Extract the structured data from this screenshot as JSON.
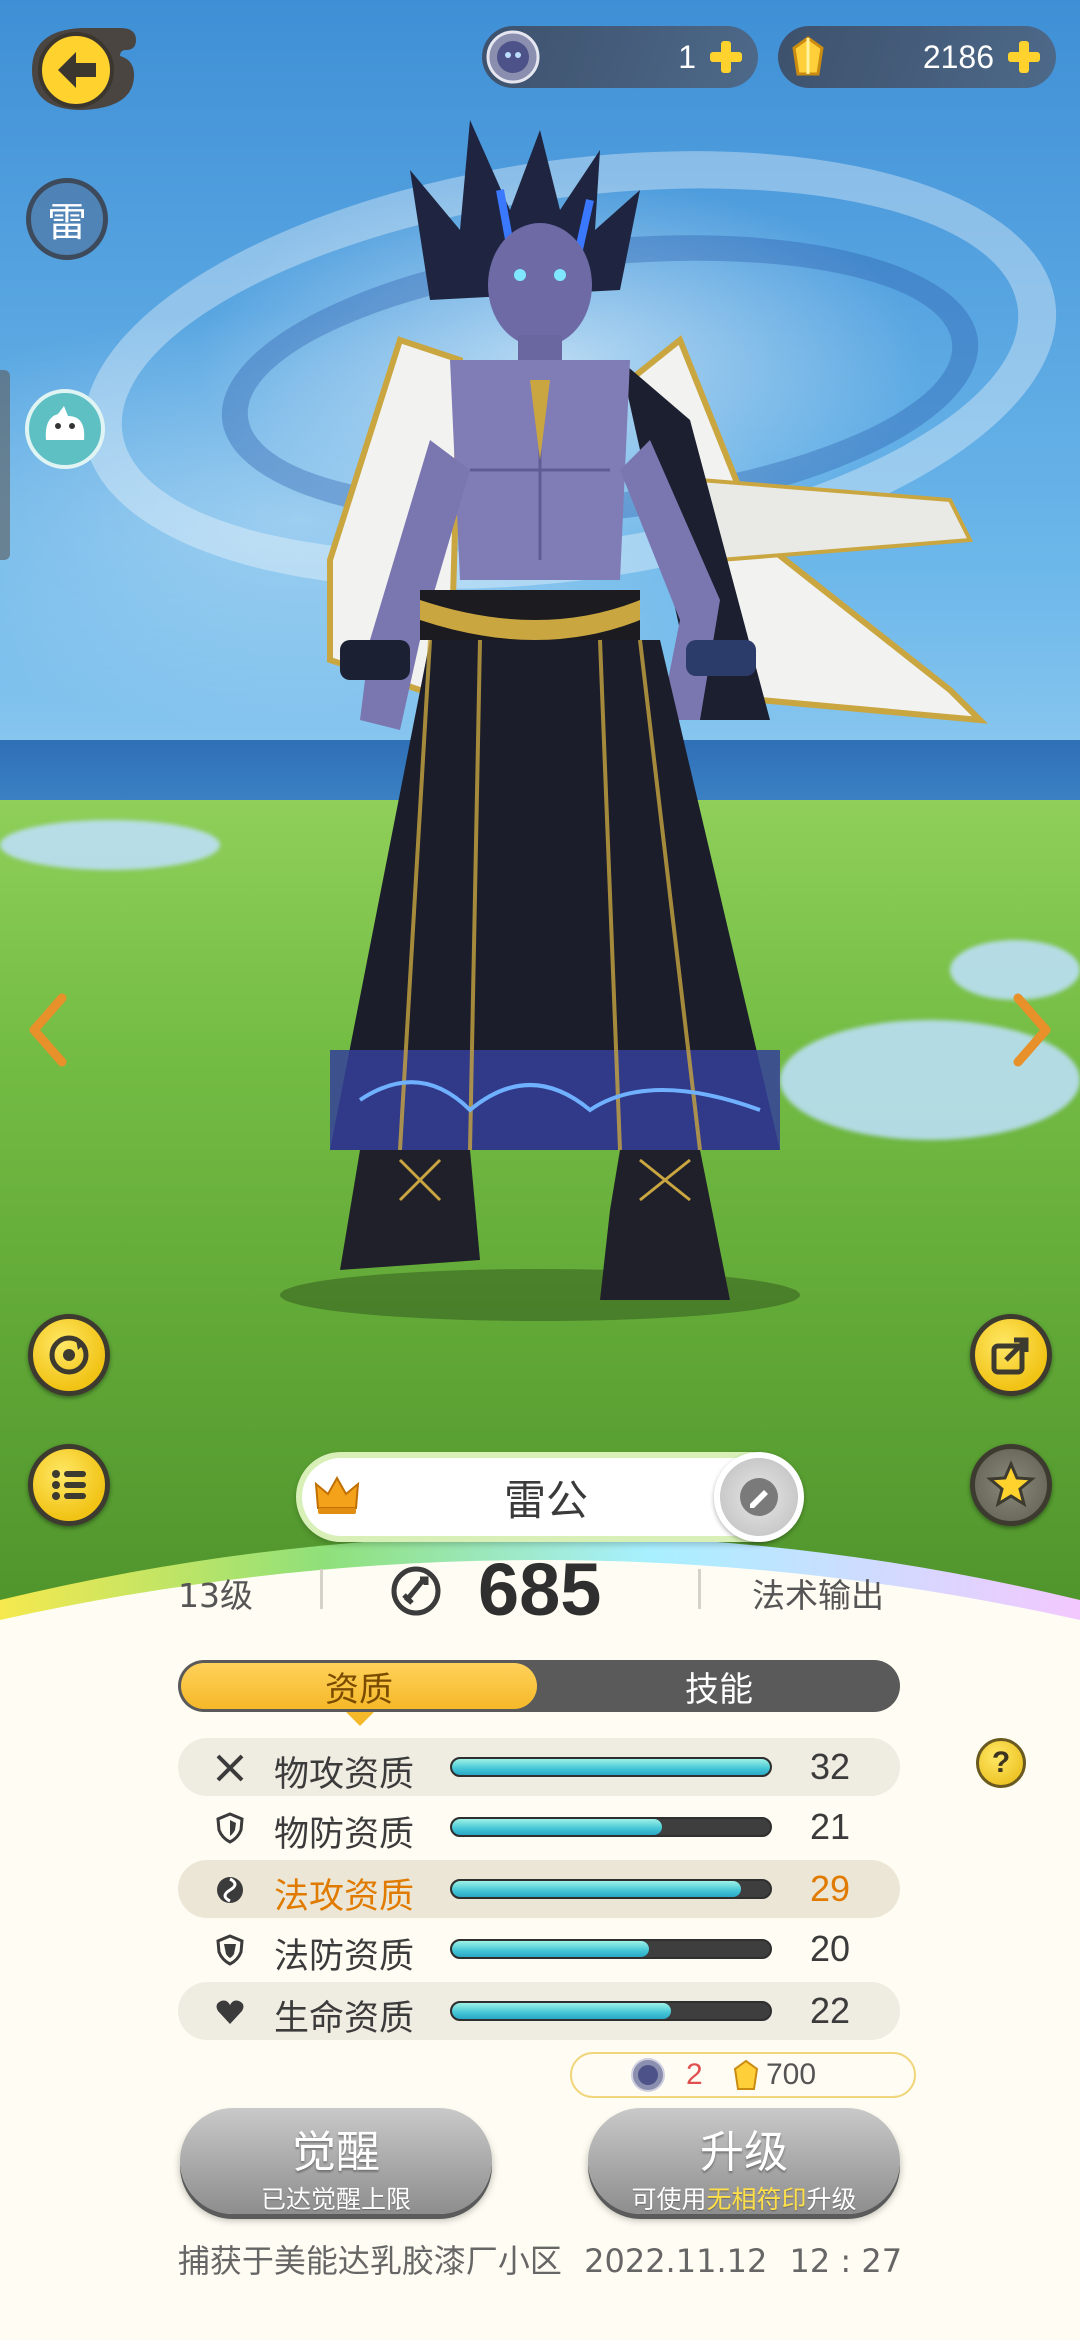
{
  "header": {
    "back_icon": "back-arrow-icon",
    "currencies": [
      {
        "icon": "spirit-face-token-icon",
        "value": "1"
      },
      {
        "icon": "gold-crystal-icon",
        "value": "2186"
      }
    ]
  },
  "side": {
    "element_badge": "雷",
    "pet_icon": "white-pet-avatar-icon",
    "left_buttons": [
      "rotate-view-icon",
      "list-menu-icon"
    ],
    "right_buttons": [
      "share-icon",
      "favorite-star-icon"
    ]
  },
  "character": {
    "name": "雷公",
    "level": "13级",
    "power": "685",
    "role": "法术输出"
  },
  "tabs": {
    "active": "资质",
    "inactive": "技能"
  },
  "attributes": [
    {
      "label": "物攻资质",
      "value": "32",
      "fill": 1.0,
      "icon": "crossed-swords-icon",
      "highlight": false
    },
    {
      "label": "物防资质",
      "value": "21",
      "fill": 0.66,
      "icon": "shield-icon",
      "highlight": false
    },
    {
      "label": "法攻资质",
      "value": "29",
      "fill": 0.91,
      "icon": "magic-orb-icon",
      "highlight": true
    },
    {
      "label": "法防资质",
      "value": "20",
      "fill": 0.62,
      "icon": "magic-shield-icon",
      "highlight": false
    },
    {
      "label": "生命资质",
      "value": "22",
      "fill": 0.69,
      "icon": "heart-icon",
      "highlight": false
    }
  ],
  "cost": {
    "token_count": "2",
    "crystal_count": "700"
  },
  "buttons": {
    "awaken": {
      "title": "觉醒",
      "subtitle": "已达觉醒上限"
    },
    "upgrade": {
      "title": "升级",
      "subtitle_prefix": "可使用",
      "subtitle_highlight": "无相符印",
      "subtitle_suffix": "升级"
    }
  },
  "footer": {
    "caught_at": "捕获于美能达乳胶漆厂小区",
    "date": "2022.11.12",
    "time": "12 : 27"
  },
  "colors": {
    "accent_yellow": "#f5b829",
    "highlight_orange": "#e07b00",
    "bar_fill": "#45c6d6"
  }
}
